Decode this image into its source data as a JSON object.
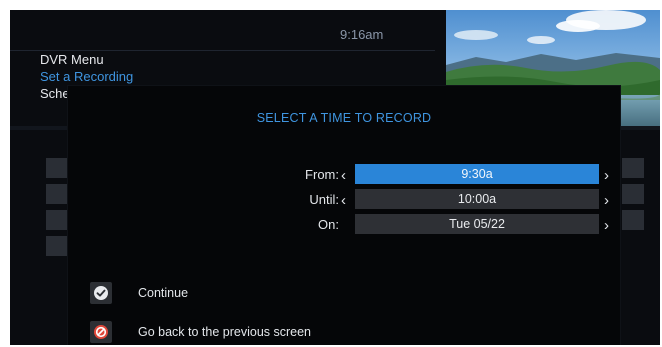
{
  "header": {
    "time": "9:16am",
    "menu_title": "DVR Menu",
    "menu_subtitle": "Set a Recording",
    "menu_third_partial": "Sche"
  },
  "dialog": {
    "title": "SELECT A TIME TO RECORD",
    "rows": [
      {
        "label": "From:",
        "value": "9:30a",
        "selected": true
      },
      {
        "label": "Until:",
        "value": "10:00a",
        "selected": false
      },
      {
        "label": "On:",
        "value": "Tue 05/22",
        "selected": false
      }
    ],
    "options": [
      {
        "label": "Continue",
        "icon": "checkmark-icon"
      },
      {
        "label": "Go back to the previous screen",
        "icon": "no-sign-icon"
      }
    ]
  },
  "colors": {
    "accent": "#2a85d8",
    "title_blue": "#3f95e0",
    "field_bg": "#2e3035",
    "screen_bg": "#0a0c10",
    "confirm_icon": "#e9ebee",
    "cancel_icon": "#e0473a"
  }
}
